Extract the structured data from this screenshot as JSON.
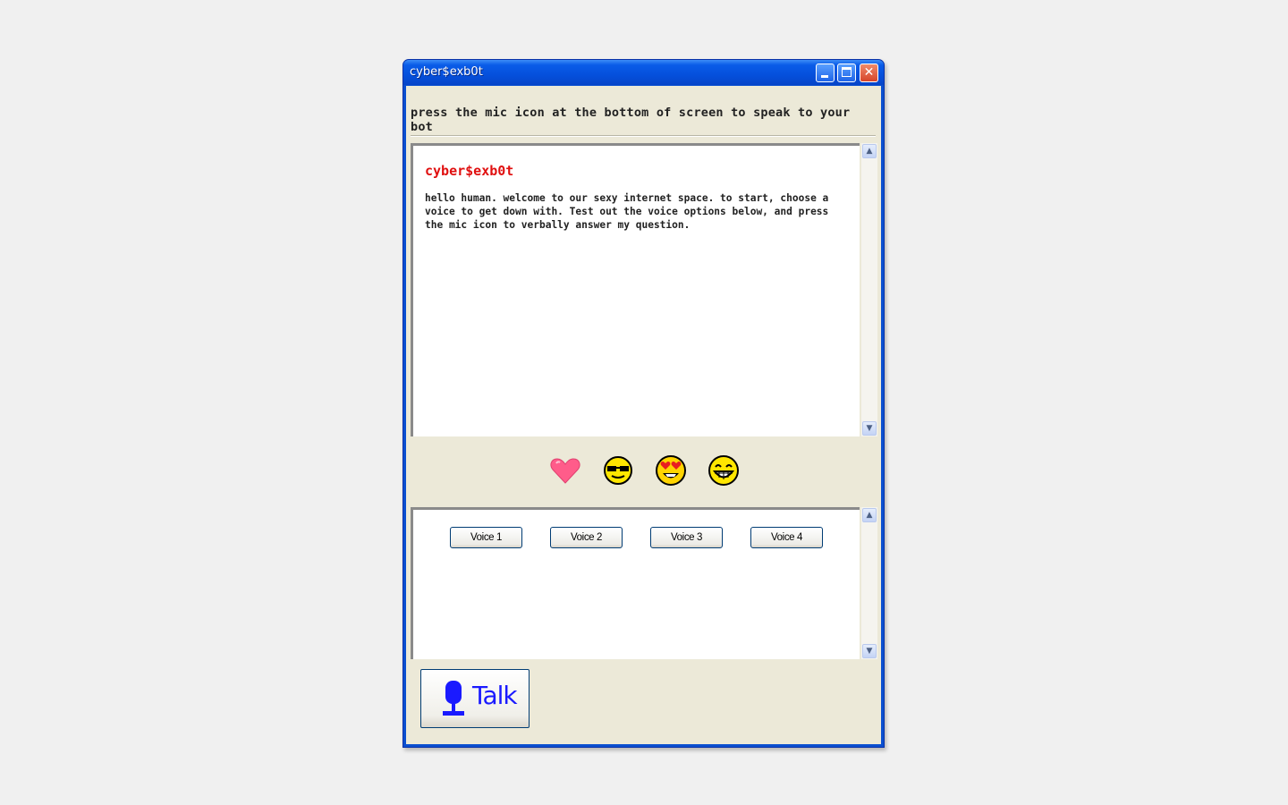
{
  "window": {
    "title": "cyber$exb0t",
    "controls": {
      "minimize": "minimize",
      "maximize": "maximize",
      "close": "close"
    }
  },
  "instruction": "press the mic icon at the bottom of screen to speak to your bot",
  "chat": {
    "sender": "cyber$exb0t",
    "message": "hello human. welcome to our sexy internet space. to start, choose a voice to get down with. Test out the voice options below, and press the mic icon to verbally answer my question."
  },
  "emojis": [
    {
      "icon": "heart-icon"
    },
    {
      "icon": "sunglasses-face-icon"
    },
    {
      "icon": "heart-eyes-face-icon"
    },
    {
      "icon": "grinning-face-icon"
    }
  ],
  "voices": [
    "Voice 1",
    "Voice 2",
    "Voice 3",
    "Voice 4"
  ],
  "talk_button": {
    "label": "Talk",
    "icon": "microphone-icon"
  },
  "colors": {
    "bot_name": "#e01010",
    "talk_label": "#1a1aff",
    "titlebar": "#0a5ce8"
  }
}
